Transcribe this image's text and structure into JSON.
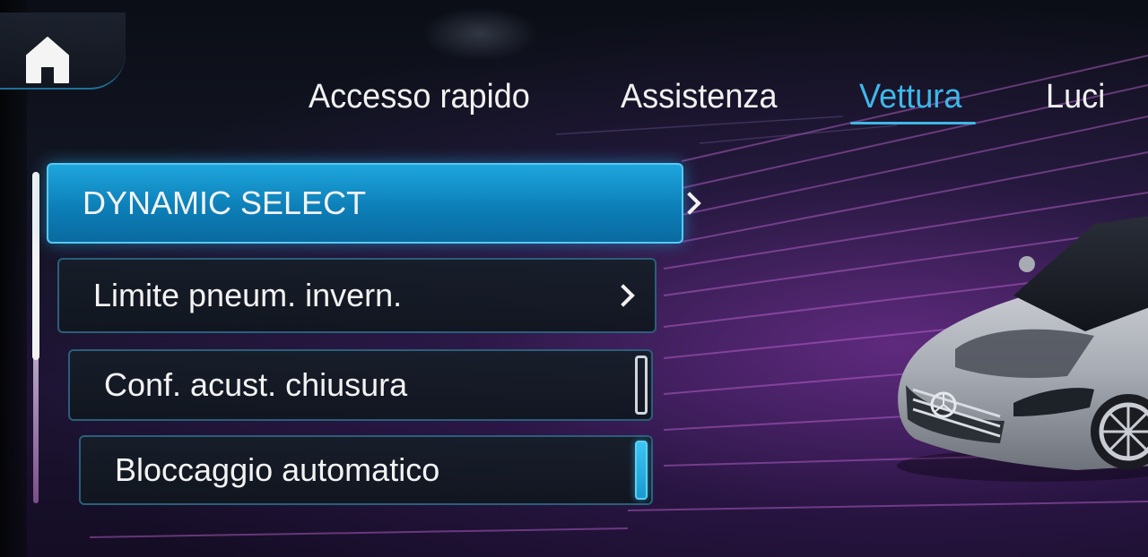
{
  "home": {
    "icon": "home-icon"
  },
  "tabs": [
    {
      "label": "Accesso rapido",
      "active": false
    },
    {
      "label": "Assistenza",
      "active": false
    },
    {
      "label": "Vettura",
      "active": true
    },
    {
      "label": "Luci",
      "active": false
    }
  ],
  "menu": {
    "items": [
      {
        "label": "DYNAMIC SELECT",
        "control": "chevron-right-icon",
        "selected": true
      },
      {
        "label": "Limite pneum. invern.",
        "control": "chevron-right-icon",
        "selected": false
      },
      {
        "label": "Conf. acust. chiusura",
        "control": "checkbox",
        "checked": false
      },
      {
        "label": "Bloccaggio automatico",
        "control": "checkbox",
        "checked": true
      }
    ]
  },
  "colors": {
    "accent": "#3fb7e8",
    "selected_item": "#1ea6dd",
    "text": "#f3f3f3",
    "background": "#121522",
    "glow": "#963cbe"
  }
}
